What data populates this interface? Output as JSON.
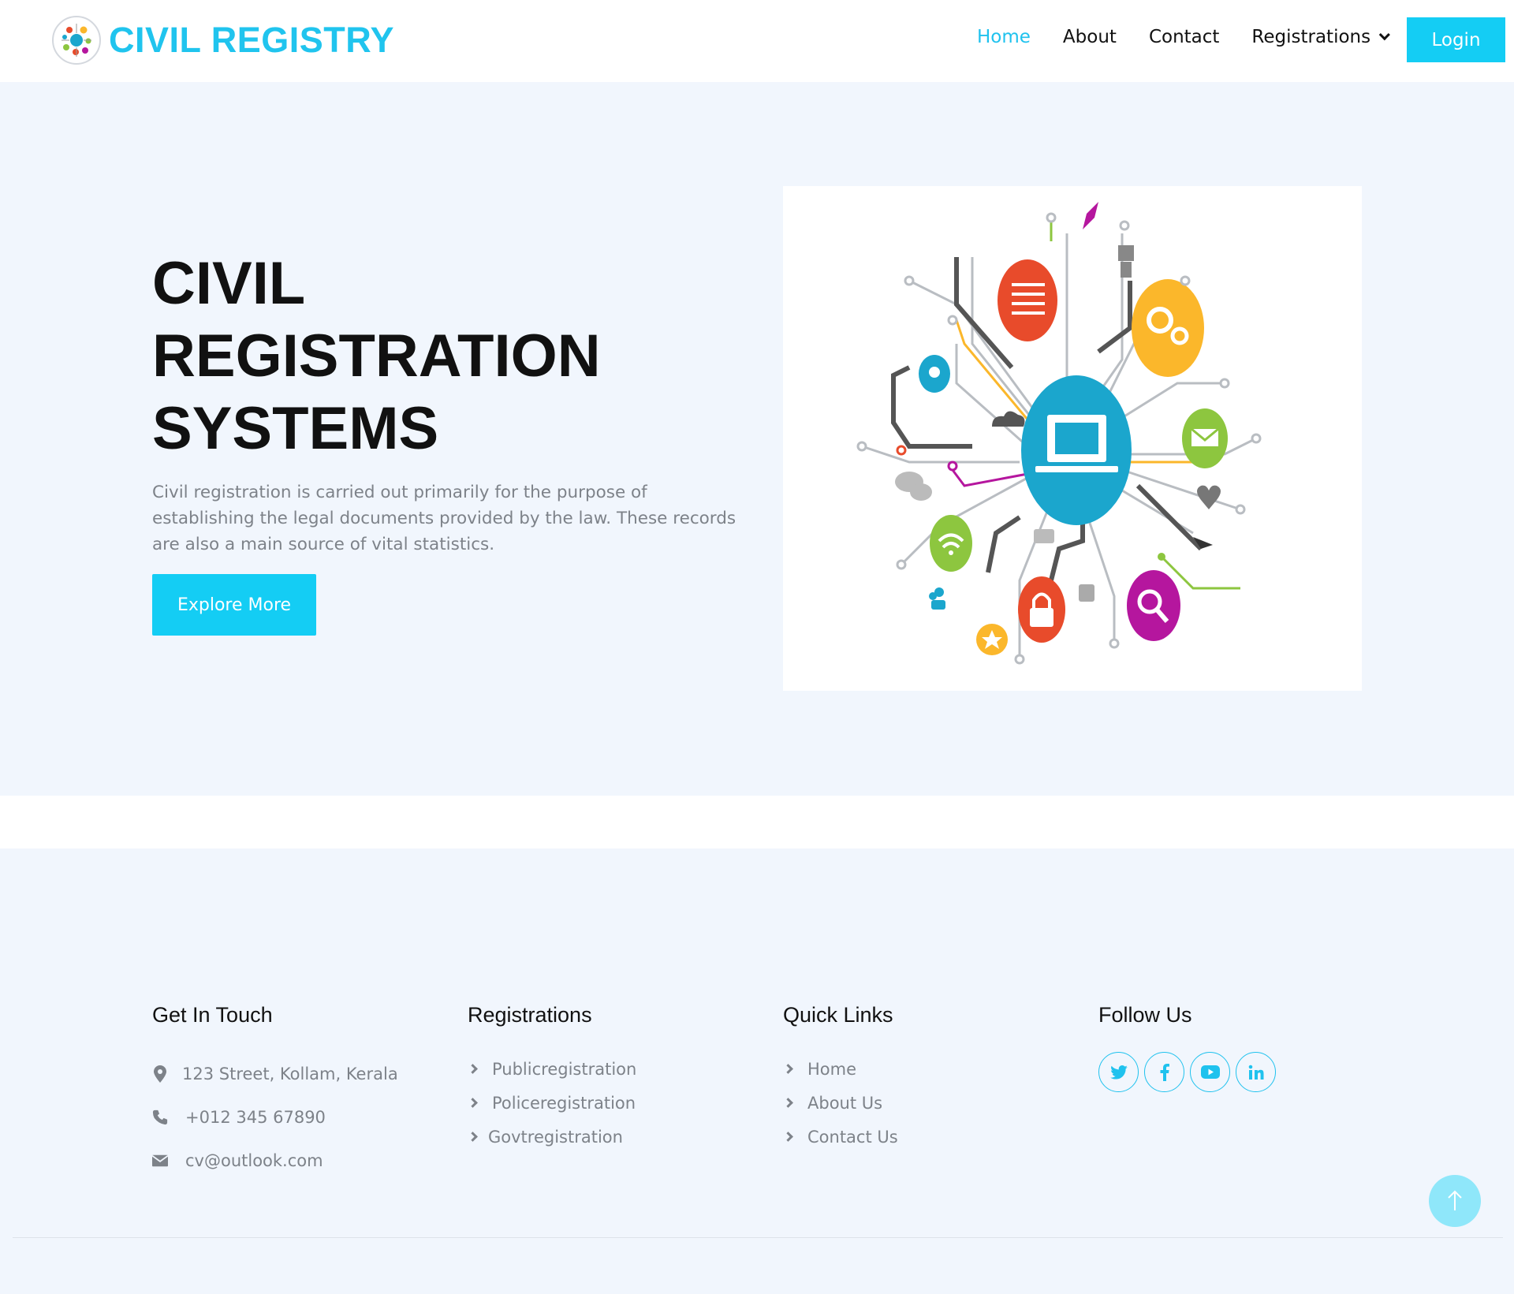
{
  "brand": {
    "name": "CIVIL REGISTRY",
    "color": "#20c4ee"
  },
  "nav": {
    "items": [
      {
        "label": "Home",
        "active": true
      },
      {
        "label": "About",
        "active": false
      },
      {
        "label": "Contact",
        "active": false
      },
      {
        "label": "Registrations",
        "active": false,
        "dropdown": true
      }
    ],
    "login_label": "Login"
  },
  "hero": {
    "title_lines": [
      "CIVIL",
      "REGISTRATION",
      "SYSTEMS"
    ],
    "text": "Civil registration is carried out primarily for the purpose of establishing the legal documents provided by the law. These records are also a main source of vital statistics.",
    "button_label": "Explore More"
  },
  "footer": {
    "get_in_touch": {
      "title": "Get In Touch",
      "address": "123 Street, Kollam, Kerala",
      "phone": "+012 345 67890",
      "email": "cv@outlook.com"
    },
    "registrations": {
      "title": "Registrations",
      "items": [
        "Publicregistration",
        "Policeregistration",
        "Govtregistration"
      ]
    },
    "quick_links": {
      "title": "Quick Links",
      "items": [
        "Home",
        "About Us",
        "Contact Us"
      ]
    },
    "follow_us": {
      "title": "Follow Us",
      "icons": [
        "twitter-icon",
        "facebook-icon",
        "youtube-icon",
        "linkedin-icon"
      ]
    }
  },
  "colors": {
    "accent": "#14cdf4",
    "hero_bg": "#f1f6fd",
    "muted_text": "#7d8289"
  }
}
